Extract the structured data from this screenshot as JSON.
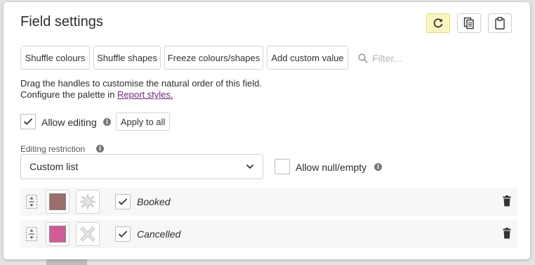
{
  "header": {
    "title": "Field settings"
  },
  "toolbar": {
    "buttons": [
      "Shuffle colours",
      "Shuffle shapes",
      "Freeze colours/shapes",
      "Add custom value"
    ],
    "filter_placeholder": "Filter..."
  },
  "description": {
    "line1": "Drag the handles to customise the natural order of this field.",
    "line2_prefix": "Configure the palette in ",
    "line2_link": "Report styles."
  },
  "editing": {
    "allow_editing_label": "Allow editing",
    "allow_editing_checked": true,
    "apply_to_all": "Apply to all",
    "restriction_label": "Editing restriction",
    "restriction_value": "Custom list",
    "allow_null_label": "Allow null/empty",
    "allow_null_checked": false
  },
  "values": [
    {
      "label": "Booked",
      "color": "#9a6e6a",
      "shape": "starburst",
      "checked": true
    },
    {
      "label": "Cancelled",
      "color": "#cf5e98",
      "shape": "cross",
      "checked": true
    }
  ],
  "colors": {
    "accent_refresh_bg": "#fbf6bf",
    "link": "#6b2a7a"
  },
  "icons": {
    "refresh": "refresh-icon",
    "copy": "copy-icon",
    "paste": "clipboard-icon",
    "search": "search-icon",
    "info": "info-icon",
    "chevron": "chevron-down-icon",
    "drag": "drag-handle-icon",
    "delete": "trash-icon"
  }
}
